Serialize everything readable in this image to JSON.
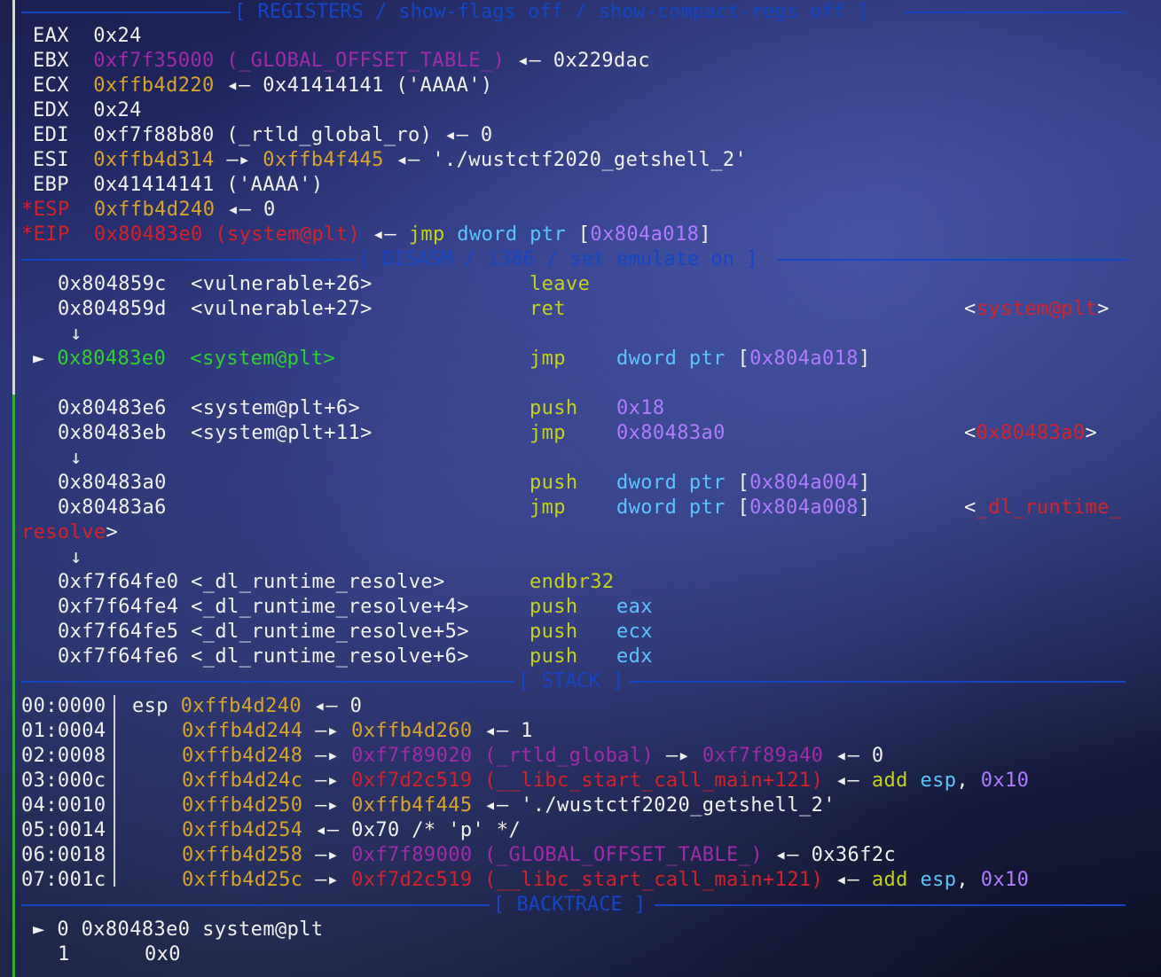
{
  "registers_header": "[ REGISTERS / show-flags off / show-compact-regs off ]",
  "disasm_header": "[ DISASM / i386 / set emulate on ]",
  "stack_header": "[ STACK ]",
  "backtrace_header": "[ BACKTRACE ]",
  "colors": {
    "yellow": "#d9a42a",
    "magenta": "#a02ca8",
    "red": "#d2232a",
    "green": "#2fd12f",
    "olive": "#c4d21a",
    "cyan": "#5cc4ff",
    "purple": "#b07cff",
    "separator": "#1446c4"
  },
  "registers": {
    "eax": {
      "name": "EAX",
      "value": "0x24"
    },
    "ebx": {
      "name": "EBX",
      "value": "0xf7f35000",
      "sym": "(_GLOBAL_OFFSET_TABLE_)",
      "arrow": "◂—",
      "deref": "0x229dac"
    },
    "ecx": {
      "name": "ECX",
      "value": "0xffb4d220",
      "arrow": "◂—",
      "deref": "0x41414141 ('AAAA')"
    },
    "edx": {
      "name": "EDX",
      "value": "0x24"
    },
    "edi": {
      "name": "EDI",
      "value": "0xf7f88b80 (_rtld_global_ro)",
      "arrow": "◂—",
      "deref": "0"
    },
    "esi": {
      "name": "ESI",
      "value": "0xffb4d314",
      "arrow1": "—▸",
      "value2": "0xffb4f445",
      "arrow2": "◂—",
      "deref": "'./wustctf2020_getshell_2'"
    },
    "ebp": {
      "name": "EBP",
      "value": "0x41414141 ('AAAA')"
    },
    "esp": {
      "mark": "*",
      "name": "ESP",
      "value": "0xffb4d240",
      "arrow": "◂—",
      "deref": "0"
    },
    "eip": {
      "mark": "*",
      "name": "EIP",
      "value": "0x80483e0 (system@plt)",
      "arrow": "◂—",
      "mnem": "jmp",
      "op1": "dword ptr",
      "lbr": "[",
      "addr": "0x804a018",
      "rbr": "]"
    }
  },
  "disasm": {
    "l1": {
      "addr": "0x804859c",
      "sym": "<vulnerable+26>",
      "mnem": "leave"
    },
    "l2": {
      "addr": "0x804859d",
      "sym": "<vulnerable+27>",
      "mnem": "ret",
      "lt": "<",
      "target": "system@plt",
      "gt": ">"
    },
    "down1": "↓",
    "l3": {
      "marker": "►",
      "addr": "0x80483e0",
      "sym": "<system@plt>",
      "mnem": "jmp",
      "op": "dword ptr",
      "lbr": "[",
      "addr2": "0x804a018",
      "rbr": "]"
    },
    "l4": {
      "addr": "0x80483e6",
      "sym": "<system@plt+6>",
      "mnem": "push",
      "op": "0x18"
    },
    "l5": {
      "addr": "0x80483eb",
      "sym": "<system@plt+11>",
      "mnem": "jmp",
      "op": "0x80483a0",
      "lt": "<",
      "target": "0x80483a0",
      "gt": ">"
    },
    "down2": "↓",
    "l6": {
      "addr": "0x80483a0",
      "mnem": "push",
      "op": "dword ptr",
      "lbr": "[",
      "addr2": "0x804a004",
      "rbr": "]"
    },
    "l7": {
      "addr": "0x80483a6",
      "mnem": "jmp",
      "op": "dword ptr",
      "lbr": "[",
      "addr2": "0x804a008",
      "rbr": "]",
      "lt": "<",
      "target": "_dl_runtime_"
    },
    "l7b": {
      "target": "resolve",
      "gt": ">"
    },
    "down3": "↓",
    "l8": {
      "addr": "0xf7f64fe0",
      "sym": "<_dl_runtime_resolve>",
      "mnem": "endbr32"
    },
    "l9": {
      "addr": "0xf7f64fe4",
      "sym": "<_dl_runtime_resolve+4>",
      "mnem": "push",
      "op": "eax"
    },
    "l10": {
      "addr": "0xf7f64fe5",
      "sym": "<_dl_runtime_resolve+5>",
      "mnem": "push",
      "op": "ecx"
    },
    "l11": {
      "addr": "0xf7f64fe6",
      "sym": "<_dl_runtime_resolve+6>",
      "mnem": "push",
      "op": "edx"
    }
  },
  "stack": {
    "s0": {
      "off": "00:0000",
      "reg": "esp",
      "addr": "0xffb4d240",
      "arrow": "◂—",
      "val": "0"
    },
    "s1": {
      "off": "01:0004",
      "addr": "0xffb4d244",
      "arrow": "—▸",
      "v1": "0xffb4d260",
      "arrow2": "◂—",
      "val": "1"
    },
    "s2": {
      "off": "02:0008",
      "addr": "0xffb4d248",
      "arrow": "—▸",
      "v1": "0xf7f89020 (_rtld_global)",
      "arrow2": "—▸",
      "v2": "0xf7f89a40",
      "arrow3": "◂—",
      "val": "0"
    },
    "s3": {
      "off": "03:000c",
      "addr": "0xffb4d24c",
      "arrow": "—▸",
      "v1": "0xf7d2c519 (__libc_start_call_main+121)",
      "arrow2": "◂—",
      "mnem": "add",
      "op1": "esp",
      "comma": ",",
      "op2": "0x10"
    },
    "s4": {
      "off": "04:0010",
      "addr": "0xffb4d250",
      "arrow": "—▸",
      "v1": "0xffb4f445",
      "arrow2": "◂—",
      "val": "'./wustctf2020_getshell_2'"
    },
    "s5": {
      "off": "05:0014",
      "addr": "0xffb4d254",
      "arrow": "◂—",
      "val": "0x70 /* 'p' */"
    },
    "s6": {
      "off": "06:0018",
      "addr": "0xffb4d258",
      "arrow": "—▸",
      "v1": "0xf7f89000 (_GLOBAL_OFFSET_TABLE_)",
      "arrow2": "◂—",
      "val": "0x36f2c"
    },
    "s7": {
      "off": "07:001c",
      "addr": "0xffb4d25c",
      "arrow": "—▸",
      "v1": "0xf7d2c519 (__libc_start_call_main+121)",
      "arrow2": "◂—",
      "mnem": "add",
      "op1": "esp",
      "comma": ",",
      "op2": "0x10"
    }
  },
  "backtrace": {
    "b0": {
      "marker": "►",
      "idx": "0",
      "addr": "0x80483e0",
      "sym": "system@plt"
    },
    "b1": {
      "idx": "1",
      "addr": "0x0"
    }
  }
}
